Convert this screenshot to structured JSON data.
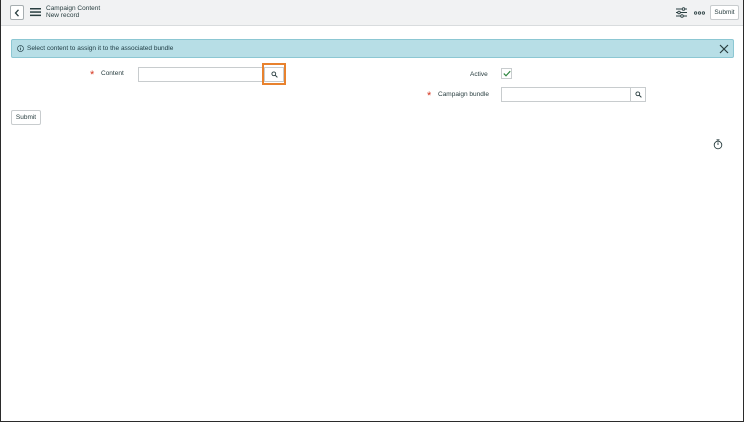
{
  "header": {
    "title": "Campaign Content",
    "subtitle": "New record",
    "submit_label": "Submit",
    "icons": {
      "back": "chevron-left-icon",
      "menu": "hamburger-menu-icon",
      "settings": "sliders-icon",
      "more": "ellipsis-icon"
    }
  },
  "banner": {
    "text": "Select content to assign it to the associated bundle",
    "icons": {
      "info": "info-circle-icon",
      "close": "close-icon"
    }
  },
  "form": {
    "content": {
      "label": "Content",
      "required": true,
      "value": ""
    },
    "active": {
      "label": "Active",
      "checked": true
    },
    "campaign_bundle": {
      "label": "Campaign bundle",
      "required": true,
      "value": ""
    },
    "submit_label": "Submit",
    "required_marker": "*"
  },
  "colors": {
    "accent_highlight": "#e8822e",
    "required": "#d5351f",
    "banner_bg": "#b7dee6",
    "header_bg": "#f1f2f3",
    "check": "#2e8540"
  }
}
